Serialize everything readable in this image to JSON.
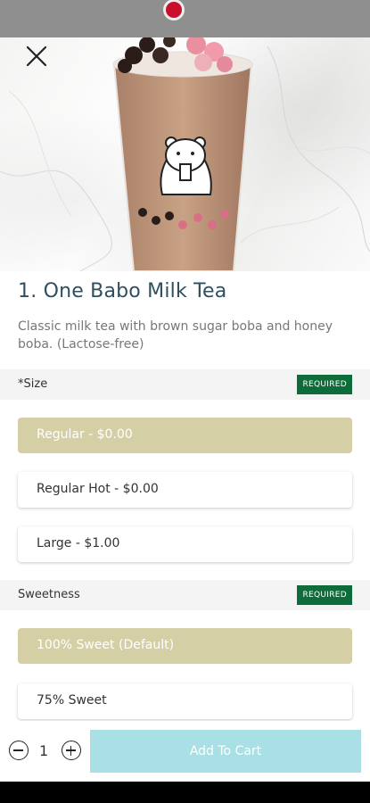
{
  "product": {
    "title": "1. One Babo Milk Tea",
    "description": "Classic milk tea with brown sugar boba and honey boba. (Lactose-free)"
  },
  "sections": [
    {
      "label": "*Size",
      "badge": "REQUIRED",
      "options": [
        {
          "label": "Regular - $0.00",
          "selected": true
        },
        {
          "label": "Regular Hot - $0.00",
          "selected": false
        },
        {
          "label": "Large - $1.00",
          "selected": false
        }
      ]
    },
    {
      "label": "Sweetness",
      "badge": "REQUIRED",
      "options": [
        {
          "label": "100% Sweet (Default)",
          "selected": true
        },
        {
          "label": "75% Sweet",
          "selected": false
        }
      ]
    }
  ],
  "cart": {
    "quantity": "1",
    "add_label": "Add To Cart"
  },
  "colors": {
    "selected_option": "#d5cfa6",
    "badge": "#0e6b3a",
    "add_button": "#a8e0e5",
    "title": "#2f4f5f"
  },
  "icons": {
    "close": "close-icon",
    "minus": "minus-circle-icon",
    "plus": "plus-circle-icon"
  }
}
